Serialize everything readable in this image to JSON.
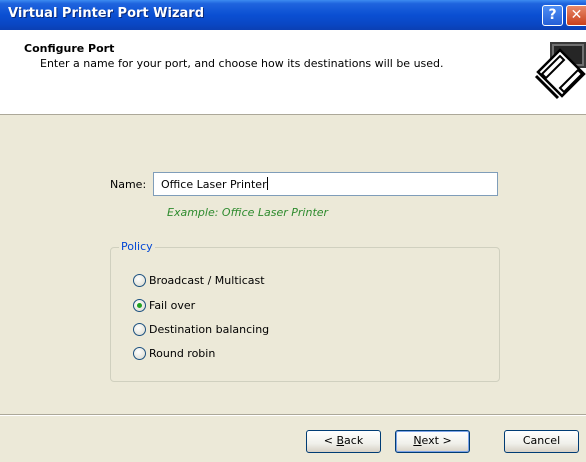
{
  "window": {
    "title": "Virtual Printer Port Wizard",
    "help_button": "?",
    "close_button": "✕"
  },
  "header": {
    "title": "Configure Port",
    "subtitle": "Enter a name for your port, and choose how its destinations will be used.",
    "icon": "printer-icon"
  },
  "form": {
    "name_label": "Name:",
    "name_value": "Office Laser Printer",
    "example": "Example: Office Laser Printer"
  },
  "policy": {
    "legend": "Policy",
    "options": [
      {
        "label": "Broadcast / Multicast",
        "checked": false
      },
      {
        "label": "Fail over",
        "checked": true
      },
      {
        "label": "Destination balancing",
        "checked": false
      },
      {
        "label": "Round robin",
        "checked": false
      }
    ]
  },
  "buttons": {
    "back_mnemonic": "B",
    "back_rest": "ack",
    "back_prefix": "< ",
    "next_mnemonic": "N",
    "next_rest": "ext >",
    "cancel": "Cancel"
  },
  "colors": {
    "title_bar": "#0a4fd3",
    "dialog_bg": "#ece9d8",
    "example_text": "#2e8b2e",
    "group_legend": "#0046d5",
    "radio_checked": "#21a121"
  }
}
